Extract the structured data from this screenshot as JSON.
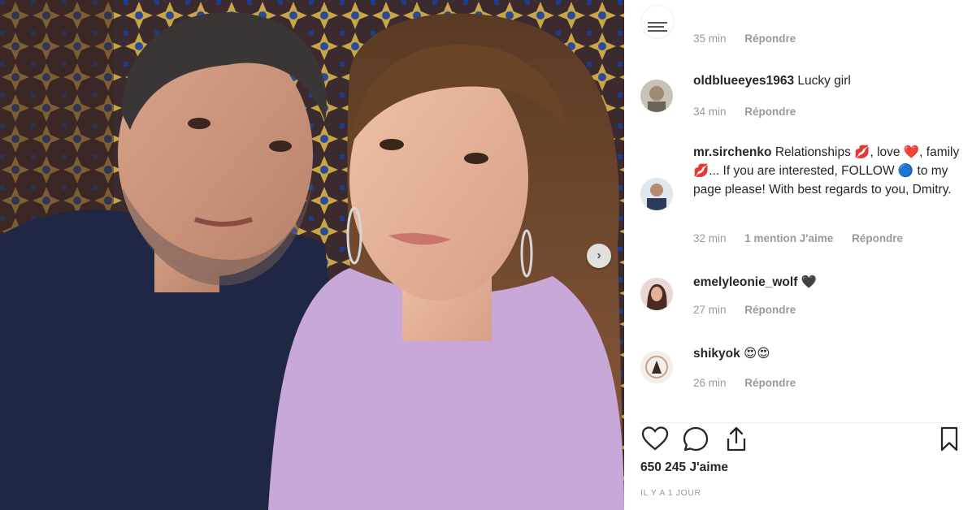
{
  "photo": {
    "alt": "",
    "next_arrow": "›"
  },
  "comments": [
    {
      "user": "",
      "text": "",
      "time": "35 min",
      "likes": "",
      "reply": "Répondre"
    },
    {
      "user": "oldblueeyes1963",
      "text": "Lucky girl",
      "time": "34 min",
      "likes": "",
      "reply": "Répondre"
    },
    {
      "user": "mr.sirchenko",
      "text_parts": [
        "Relationships ",
        "💋",
        ", love ",
        "❤️",
        ", family ",
        "💋",
        "... If you are interested, FOLLOW ",
        "🔵",
        " to my page please! With best regards to you, Dmitry."
      ],
      "time": "32 min",
      "likes": "1 mention J'aime",
      "reply": "Répondre"
    },
    {
      "user": "emelyleonie_wolf",
      "text": "🖤",
      "time": "27 min",
      "likes": "",
      "reply": "Répondre"
    },
    {
      "user": "shikyok",
      "text": "😍😍",
      "time": "26 min",
      "likes": "",
      "reply": "Répondre"
    }
  ],
  "actions": {
    "like_icon": "heart-outline-icon",
    "comment_icon": "speech-bubble-icon",
    "share_icon": "share-icon",
    "save_icon": "bookmark-icon"
  },
  "likes_count": "650 245 J'aime",
  "timestamp": "IL Y A 1 JOUR",
  "colors": {
    "muted": "#999999",
    "text": "#262626",
    "heart": "#e0245e"
  }
}
